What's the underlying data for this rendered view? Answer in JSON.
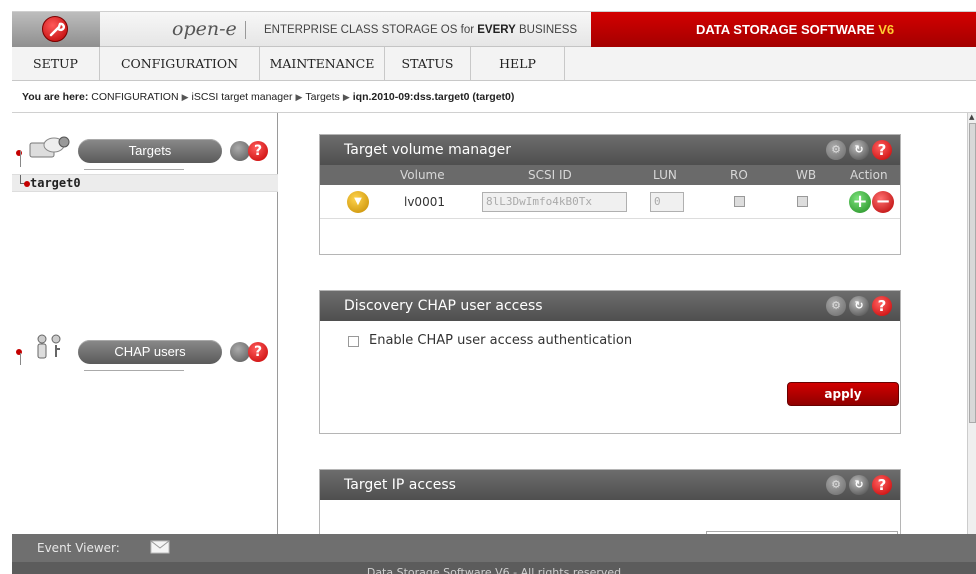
{
  "header": {
    "brand": "open-e",
    "tagline_prefix": "ENTERPRISE CLASS STORAGE OS for ",
    "tagline_bold": "EVERY",
    "tagline_suffix": " BUSINESS",
    "product": "DATA STORAGE SOFTWARE ",
    "product_version": "V6"
  },
  "menu": [
    "SETUP",
    "CONFIGURATION",
    "MAINTENANCE",
    "STATUS",
    "HELP"
  ],
  "breadcrumb": {
    "prefix": "You are here:",
    "items": [
      "CONFIGURATION",
      "iSCSI target manager",
      "Targets"
    ],
    "current": "iqn.2010-09:dss.target0 (target0)"
  },
  "left": {
    "targets_title": "Targets",
    "target_item": "target0",
    "chap_title": "CHAP users"
  },
  "target_volume": {
    "title": "Target volume manager",
    "columns": [
      "Volume",
      "SCSI ID",
      "LUN",
      "RO",
      "WB",
      "Action"
    ],
    "row": {
      "volume": "lv0001",
      "scsi_id": "8lL3DwImfo4kB0Tx",
      "lun": "0"
    }
  },
  "discovery_chap": {
    "title": "Discovery CHAP user access",
    "checkbox_label": "Enable CHAP user access authentication",
    "apply_label": "apply"
  },
  "target_ip": {
    "title": "Target IP access"
  },
  "icons": {
    "help": "?"
  },
  "status": {
    "event_viewer": "Event Viewer:",
    "footer": "Data Storage Software V6 - All rights reserved"
  }
}
